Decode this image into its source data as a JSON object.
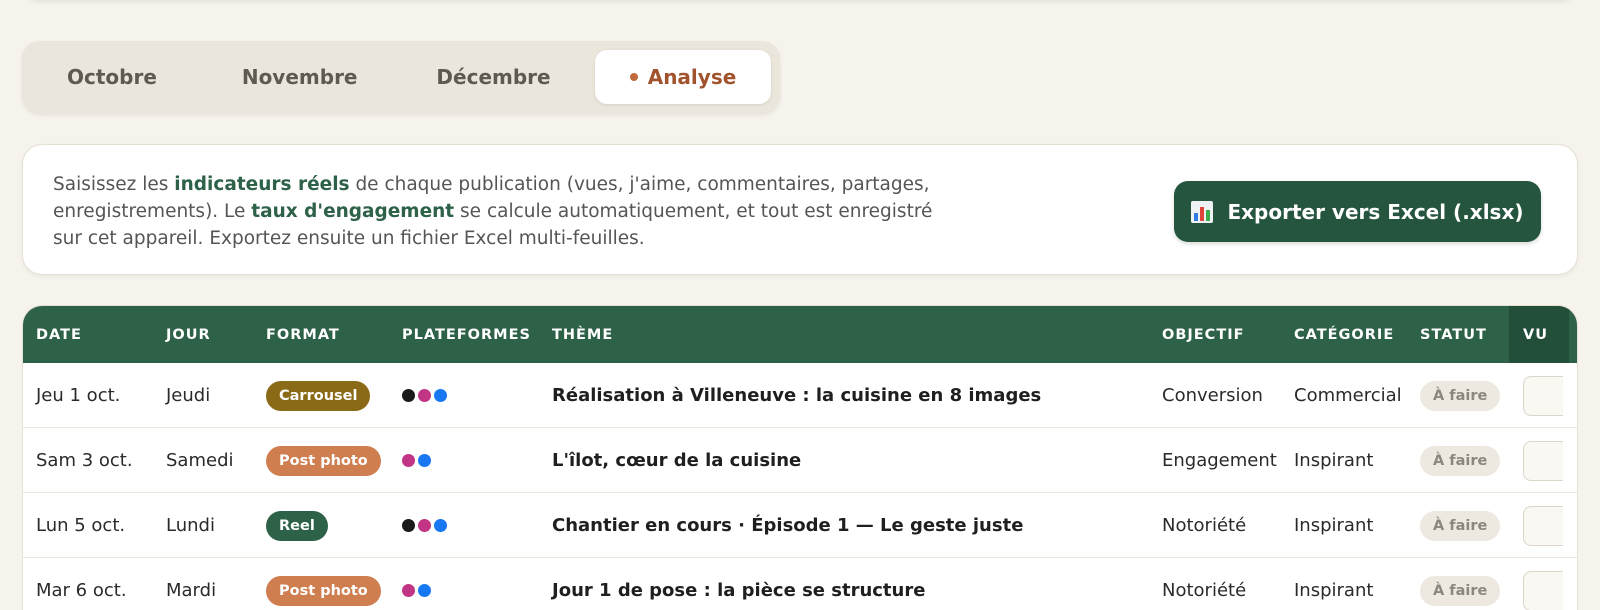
{
  "tabs": [
    {
      "label": "Octobre",
      "active": false
    },
    {
      "label": "Novembre",
      "active": false
    },
    {
      "label": "Décembre",
      "active": false
    },
    {
      "label": "Analyse",
      "active": true
    }
  ],
  "info": {
    "p1": "Saisissez les ",
    "b1": "indicateurs réels",
    "p2": " de chaque publication (vues, j'aime, commentaires, partages, enregistrements). Le ",
    "b2": "taux d'engagement",
    "p3": " se calcule automatiquement, et tout est enregistré sur cet appareil. Exportez ensuite un fichier Excel multi-feuilles."
  },
  "export_button": {
    "label": "Exporter vers Excel (.xlsx)",
    "icon": "bar-chart-icon"
  },
  "table": {
    "headers": {
      "date": "DATE",
      "jour": "JOUR",
      "format": "FORMAT",
      "plateformes": "PLATEFORMES",
      "theme": "THÈME",
      "objectif": "OBJECTIF",
      "categorie": "CATÉGORIE",
      "statut": "STATUT",
      "vues": "VU"
    },
    "rows": [
      {
        "date": "Jeu 1 oct.",
        "jour": "Jeudi",
        "format": "Carrousel",
        "platforms": [
          "#1a1a1a",
          "#c13584",
          "#1877f2"
        ],
        "theme": "Réalisation à Villeneuve : la cuisine en 8 images",
        "objectif": "Conversion",
        "categorie": "Commercial",
        "statut": "À faire"
      },
      {
        "date": "Sam 3 oct.",
        "jour": "Samedi",
        "format": "Post photo",
        "platforms": [
          "#c13584",
          "#1877f2"
        ],
        "theme": "L'îlot, cœur de la cuisine",
        "objectif": "Engagement",
        "categorie": "Inspirant",
        "statut": "À faire"
      },
      {
        "date": "Lun 5 oct.",
        "jour": "Lundi",
        "format": "Reel",
        "platforms": [
          "#1a1a1a",
          "#c13584",
          "#1877f2"
        ],
        "theme": "Chantier en cours · Épisode 1 — Le geste juste",
        "objectif": "Notoriété",
        "categorie": "Inspirant",
        "statut": "À faire"
      },
      {
        "date": "Mar 6 oct.",
        "jour": "Mardi",
        "format": "Post photo",
        "platforms": [
          "#c13584",
          "#1877f2"
        ],
        "theme": "Jour 1 de pose : la pièce se structure",
        "objectif": "Notoriété",
        "categorie": "Inspirant",
        "statut": "À faire"
      }
    ]
  },
  "format_colors": {
    "Carrousel": "#8a6a17",
    "Post photo": "#cf7e4f",
    "Reel": "#2d6148"
  },
  "colors": {
    "brand_green": "#2d6148",
    "accent": "#a0532d",
    "background": "#f6f3ec"
  }
}
